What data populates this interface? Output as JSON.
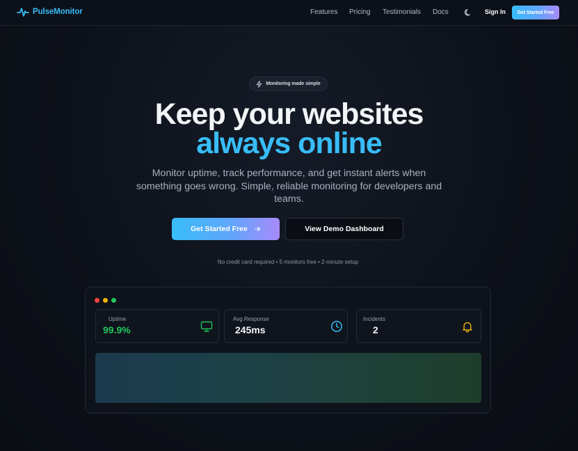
{
  "nav": {
    "brand": "PulseMonitor",
    "links": [
      "Features",
      "Pricing",
      "Testimonials",
      "Docs"
    ],
    "theme_icon": "moon-icon",
    "sign_in": "Sign In",
    "cta": "Get Started Free"
  },
  "hero": {
    "badge": "Monitoring made simple",
    "badge_icon": "lightning-icon",
    "title_line1": "Keep your websites",
    "title_line2": "always online",
    "subtitle": "Monitor uptime, track performance, and get instant alerts when something goes wrong. Simple, reliable monitoring for developers and teams.",
    "primary_button": "Get Started Free",
    "secondary_button": "View Demo Dashboard",
    "fineprint": "No credit card required • 5 monitors free • 2-minute setup"
  },
  "preview": {
    "window_dots": [
      "#ef4444",
      "#eab308",
      "#22c55e"
    ],
    "cards": [
      {
        "label": "Uptime",
        "value": "99.9%",
        "value_color": "#22c55e",
        "icon": "monitor-icon",
        "icon_color": "#22c55e"
      },
      {
        "label": "Avg Response",
        "value": "245ms",
        "value_color": "#f2f4f7",
        "icon": "clock-icon",
        "icon_color": "#38bdf8"
      },
      {
        "label": "Incidents",
        "value": "2",
        "value_color": "#f2f4f7",
        "icon": "bell-icon",
        "icon_color": "#eab308"
      }
    ]
  },
  "colors": {
    "accent": "#38bdf8",
    "gradient_end": "#a78bfa",
    "background": "#0b0f17"
  }
}
